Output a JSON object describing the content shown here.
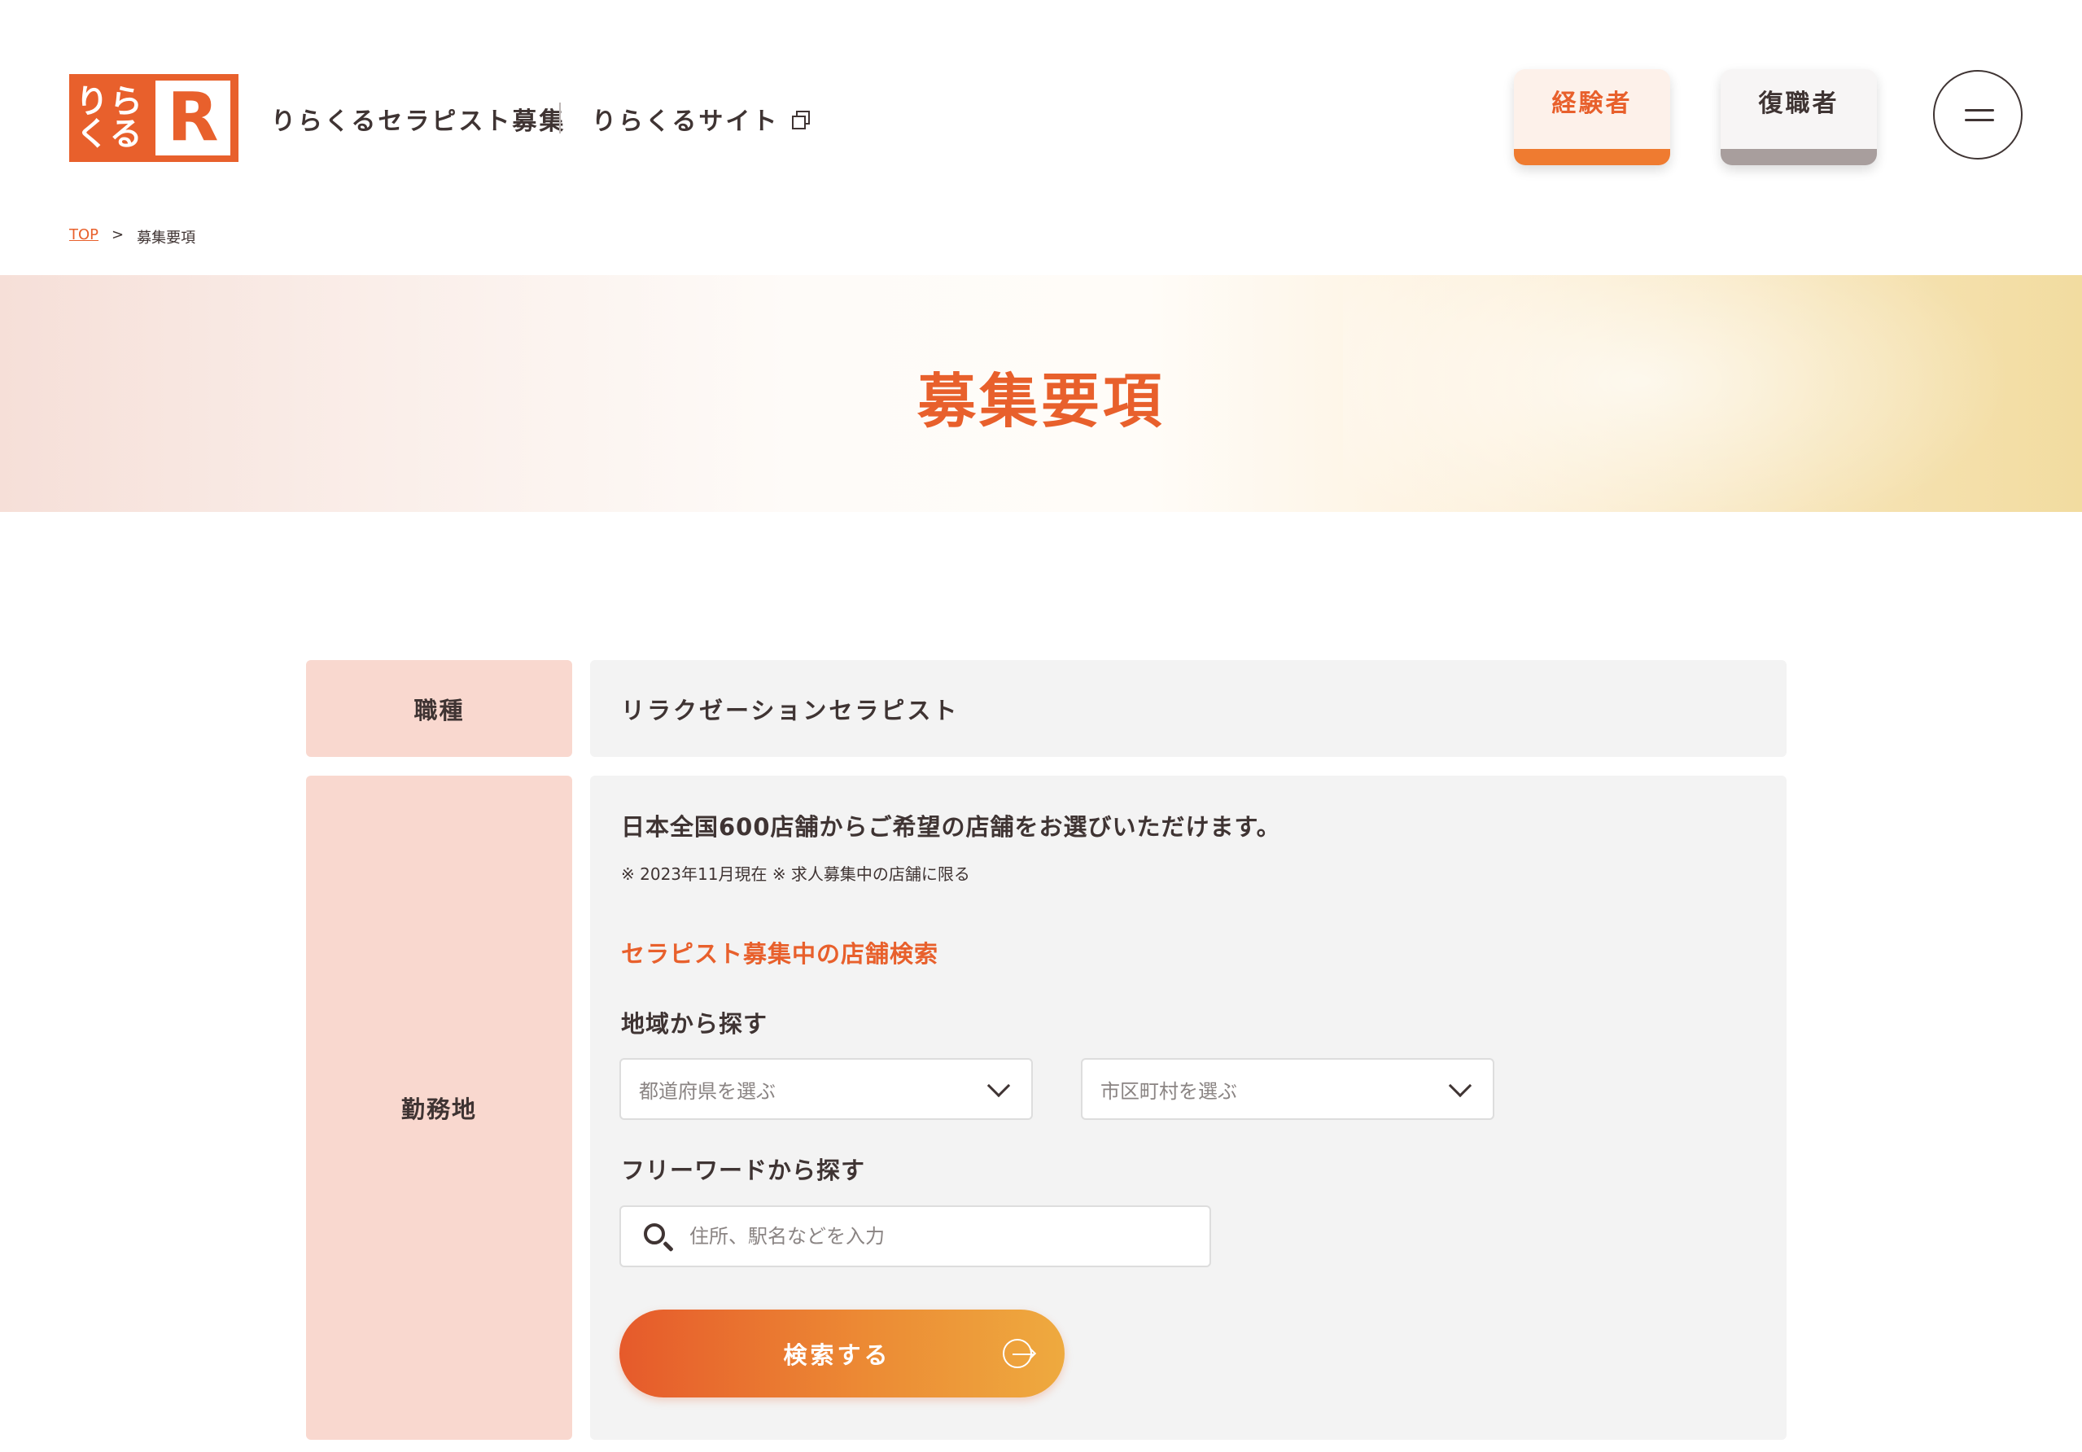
{
  "header": {
    "logo": {
      "kana_line1": "りら",
      "kana_line2": "くる",
      "letter": "R"
    },
    "site_title": "りらくるセラピスト募集",
    "site_link": "りらくるサイト",
    "btn_experienced": "経験者",
    "btn_returning": "復職者",
    "menu_icon": "hamburger-icon",
    "colors": {
      "accent": "#e8602c",
      "text": "#3f3433"
    }
  },
  "breadcrumb": {
    "top": "TOP",
    "separator": ">",
    "current": "募集要項"
  },
  "hero": {
    "title": "募集要項"
  },
  "table": {
    "job_type": {
      "label": "職種",
      "value": "リラクゼーションセラピスト"
    },
    "location": {
      "label": "勤務地",
      "lead": "日本全国600店舗からご希望の店舗をお選びいただけます。",
      "note": "※ 2023年11月現在 ※ 求人募集中の店舗に限る",
      "search_title": "セラピスト募集中の店舗検索",
      "area_title": "地域から探す",
      "pref_select": "都道府県を選ぶ",
      "city_select": "市区町村を選ぶ",
      "free_title": "フリーワードから探す",
      "free_placeholder": "住所、駅名などを入力",
      "search_button": "検索する"
    }
  }
}
